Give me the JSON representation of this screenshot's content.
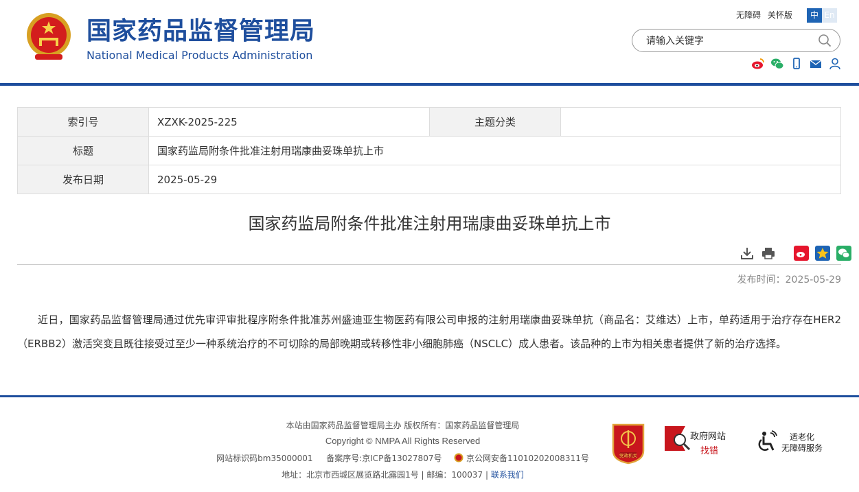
{
  "header": {
    "title_cn": "国家药品监督管理局",
    "title_en": "National Medical Products Administration",
    "menu": [
      "无障碍",
      "关怀版"
    ],
    "lang_zh": "中",
    "lang_en": "En",
    "search_placeholder": "请输入关键字"
  },
  "meta": {
    "index_label": "索引号",
    "index_value": "XZXK-2025-225",
    "topic_label": "主题分类",
    "topic_value": "",
    "title_label": "标题",
    "title_value": "国家药监局附条件批准注射用瑞康曲妥珠单抗上市",
    "date_label": "发布日期",
    "date_value": "2025-05-29"
  },
  "article": {
    "title": "国家药监局附条件批准注射用瑞康曲妥珠单抗上市",
    "pubdate": "发布时间：2025-05-29",
    "body": "近日，国家药品监督管理局通过优先审评审批程序附条件批准苏州盛迪亚生物医药有限公司申报的注射用瑞康曲妥珠单抗（商品名：艾维达）上市，单药适用于治疗存在HER2（ERBB2）激活突变且既往接受过至少一种系统治疗的不可切除的局部晚期或转移性非小细胞肺癌（NSCLC）成人患者。该品种的上市为相关患者提供了新的治疗选择。"
  },
  "footer": {
    "line1": "本站由国家药品监督管理局主办 版权所有：国家药品监督管理局",
    "line2": "Copyright © NMPA All Rights Reserved",
    "site_code": "网站标识码bm35000001",
    "icp": "备案序号:京ICP备13027807号",
    "police": "京公网安备11010202008311号",
    "address": "地址：北京市西城区展览路北露园1号 | 邮编：100037 |",
    "contact": "联系我们",
    "badge_gov_1": "政府网站",
    "badge_gov_2": "找错",
    "badge_access_1": "适老化",
    "badge_access_2": "无障碍服务",
    "badge_party": "党政机关"
  },
  "colors": {
    "brand_blue": "#1e4e9d",
    "accent_red": "#c8161d"
  }
}
